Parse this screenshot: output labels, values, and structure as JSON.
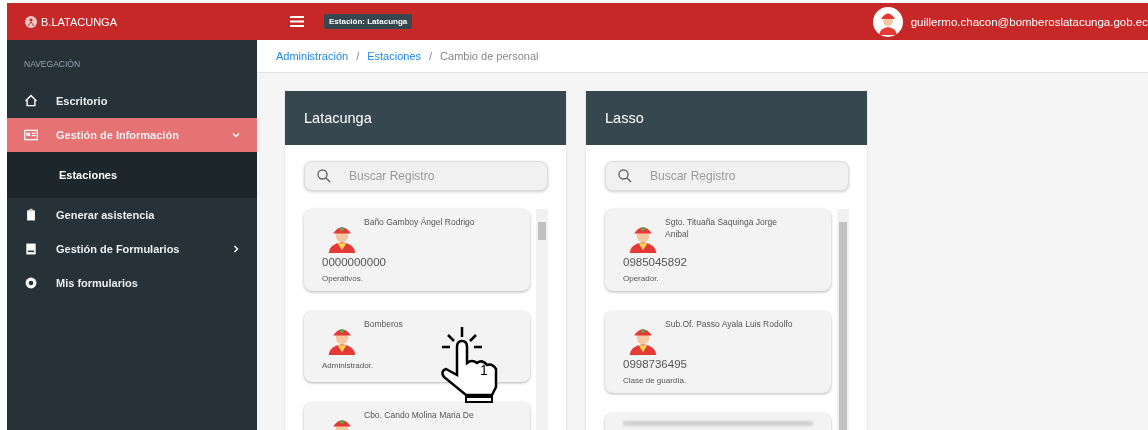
{
  "topbar": {
    "brand": "B.LATACUNGA",
    "station_badge": "Estación: Latacunga",
    "user_email": "guillermo.chacon@bomberoslatacunga.gob.ec"
  },
  "sidebar": {
    "heading": "NAVEGACIÓN",
    "items": [
      {
        "label": "Escritorio",
        "kind": "link",
        "selected": false
      },
      {
        "label": "Gestión de Información",
        "kind": "group",
        "selected": true,
        "expanded": true,
        "children": [
          {
            "label": "Estaciones"
          }
        ]
      },
      {
        "label": "Generar asistencia",
        "kind": "link",
        "selected": false
      },
      {
        "label": "Gestión de Formularios",
        "kind": "group",
        "selected": false,
        "expanded": false
      },
      {
        "label": "Mis formularios",
        "kind": "link",
        "selected": false
      }
    ]
  },
  "breadcrumb_separators": [
    "/",
    "/"
  ],
  "breadcrumb": [
    {
      "label": "Administración",
      "kind": "link"
    },
    {
      "label": "Estaciones",
      "kind": "link"
    },
    {
      "label": "Cambio de personal",
      "kind": "current"
    }
  ],
  "panels": [
    {
      "title": "Latacunga",
      "search": {
        "placeholder": "Buscar Registro"
      },
      "cards": [
        {
          "name": "Baño Gamboy Ángel Rodrigo",
          "phone": "0000000000",
          "role": "Operativos."
        },
        {
          "name": "Bomberos",
          "role": "Administrador.",
          "annotation": "1"
        },
        {
          "name": "Cbo. Cando Molina Maria De"
        }
      ]
    },
    {
      "title": "Lasso",
      "search": {
        "placeholder": "Buscar Registro"
      },
      "cards": [
        {
          "name": "Sgto. Tituaña Saquinga Jorge Anibal",
          "phone": "0985045892",
          "role": "Operador."
        },
        {
          "name": "Sub.Of. Passo Ayala Luis Rodolfo",
          "phone": "0998736495",
          "role": "Clase de guardía."
        },
        {
          "kind": "obscured"
        }
      ]
    }
  ]
}
